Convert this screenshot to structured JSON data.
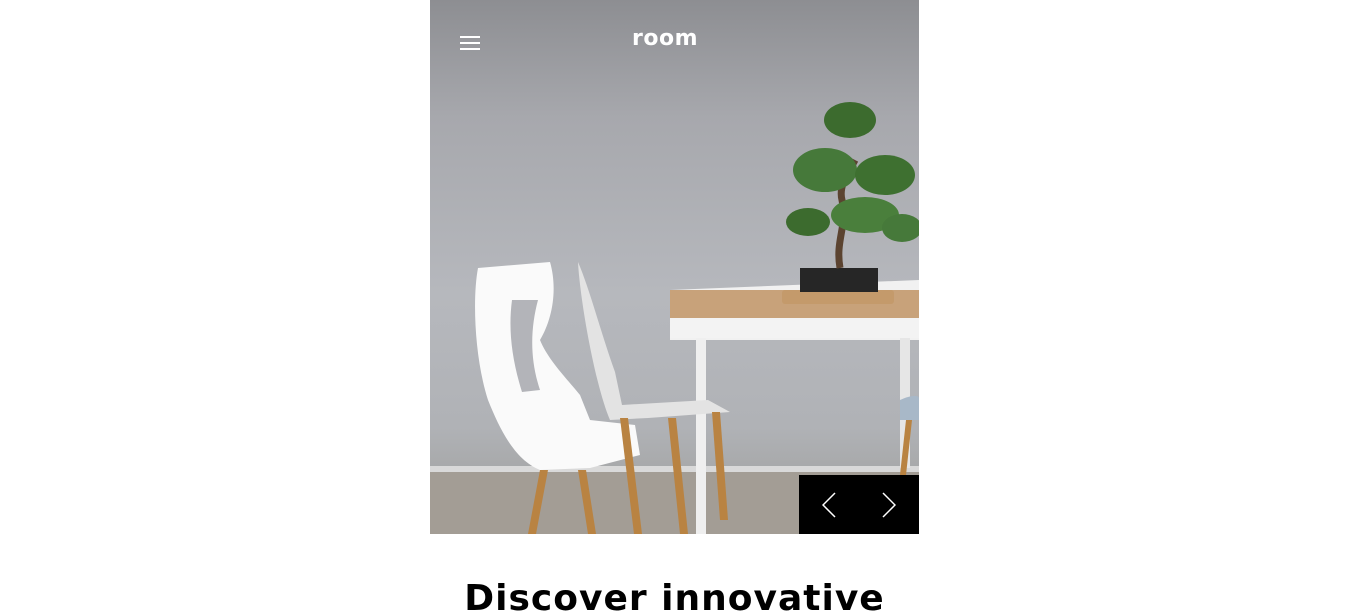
{
  "header": {
    "logo": "room",
    "menu_icon": "hamburger-icon"
  },
  "hero": {
    "image_subject": "white chairs and wooden table with bonsai tree",
    "controls": {
      "prev_icon": "chevron-left-icon",
      "next_icon": "chevron-right-icon"
    }
  },
  "main": {
    "headline": "Discover innovative"
  },
  "colors": {
    "background": "#ffffff",
    "controls_bg": "#000000",
    "text": "#000000",
    "header_text": "#ffffff"
  }
}
